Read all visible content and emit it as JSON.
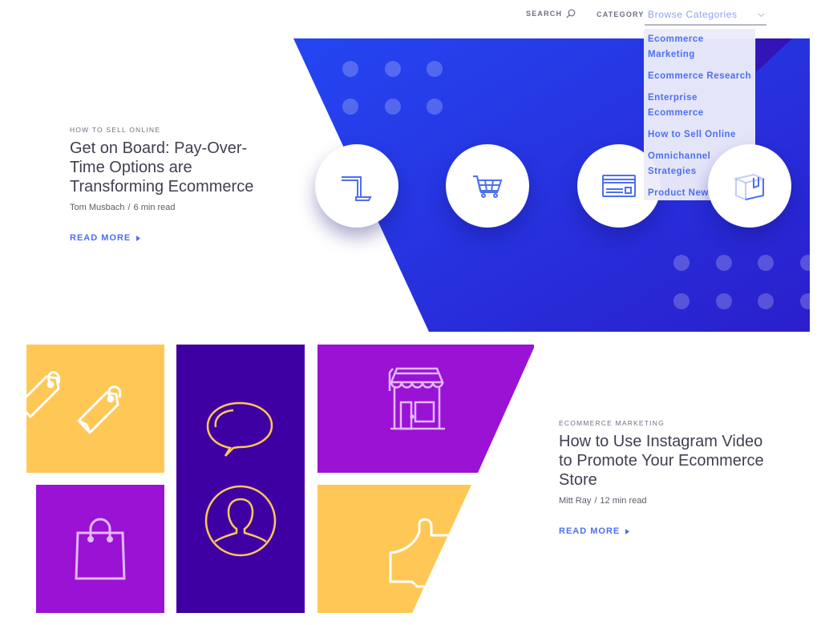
{
  "header": {
    "search_label": "SEARCH",
    "search_icon": "magnifier-icon",
    "category_label": "CATEGORY",
    "category_select": {
      "selected": "Browse Categories",
      "icon": "chevron-down-icon",
      "expanded": true,
      "options": [
        "Ecommerce Marketing",
        "Ecommerce Research",
        "Enterprise Ecommerce",
        "How to Sell Online",
        "Omnichannel Strategies",
        "Product News"
      ]
    }
  },
  "featured": {
    "category": "HOW TO SELL ONLINE",
    "title": "Get on Board: Pay-Over-Time Options are Transforming Ecommerce",
    "author": "Tom Musbach",
    "separator": "/",
    "read_time": "6 min read",
    "read_more": "READ MORE",
    "hero_icons": [
      "display-stand-icon",
      "shopping-cart-icon",
      "credit-card-icon",
      "package-box-icon"
    ]
  },
  "article2": {
    "category": "ECOMMERCE MARKETING",
    "title": "How to Use Instagram Video to Promote Your Ecommerce Store",
    "author": "Mitt Ray",
    "separator": "/",
    "read_time": "12 min read",
    "read_more": "READ MORE",
    "tile_icons": [
      "price-tags-icon",
      "shopping-bag-icon",
      "speech-bubble-icon",
      "user-avatar-icon",
      "storefront-icon",
      "thumbs-up-icon"
    ]
  },
  "colors": {
    "accent_blue": "#4d6ff0",
    "hero_blue": "#2a3be0",
    "tile_yellow": "#ffc856",
    "tile_purple": "#9a12d4",
    "tile_indigo": "#3f00a3"
  }
}
